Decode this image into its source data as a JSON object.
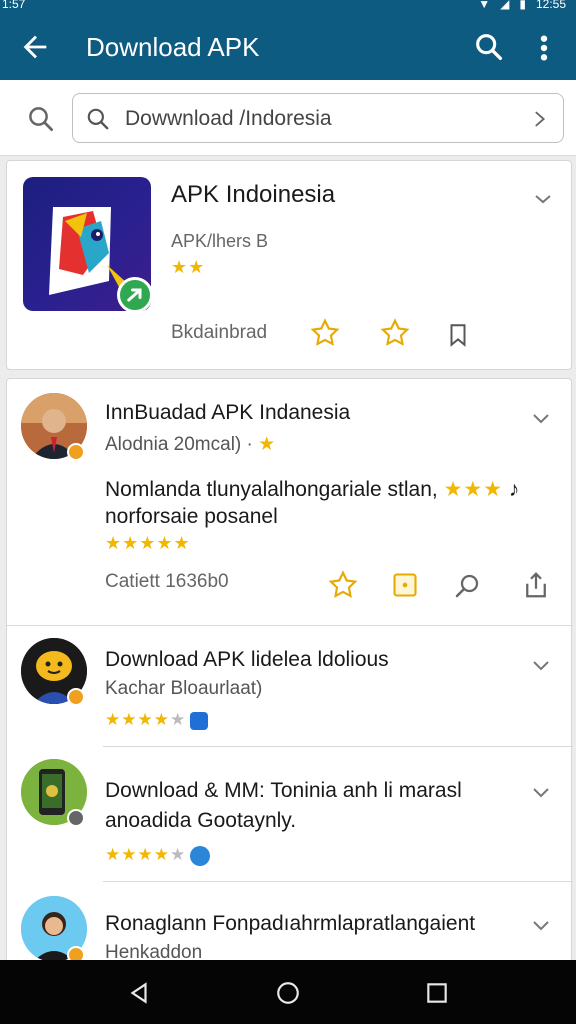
{
  "status_bar": {
    "time": "1:57",
    "clock": "12:55"
  },
  "app_bar": {
    "title": "Download APK"
  },
  "search": {
    "value": "Dowwnload /Indoresia"
  },
  "featured": {
    "title": "APK Indoinesia",
    "subtitle": "APK/lhers B",
    "rating_stars": "★★",
    "label": "Bkdainbrad"
  },
  "items": [
    {
      "title": "InnBuadad APK Indanesia",
      "subtitle": "Alodnia 20mcal) ·",
      "desc_line1": "Nomlanda tlunyalalhongariale stlan,",
      "desc_line2": "norforsaie posanel",
      "rating_stars": "★★★★★",
      "desc_stars": "★★★",
      "footer": "Catiett 1636b0"
    },
    {
      "title": "Download APK lidelea ldolious",
      "subtitle": "Kachar Bloaurlaat)",
      "rating_stars": "★★★★",
      "rating_empty": "★"
    },
    {
      "title": "Download & MM: Toninia anh li marasl",
      "subtitle": "anoadida Gootaynly.",
      "rating_stars": "★★★★",
      "rating_empty": "★"
    },
    {
      "title": "Ronaglann Fonpadıahrmlapratlangaient",
      "subtitle": "Henkaddon"
    }
  ],
  "colors": {
    "primary": "#0e5b82",
    "star": "#f2b700",
    "badge": "#f0a020"
  }
}
